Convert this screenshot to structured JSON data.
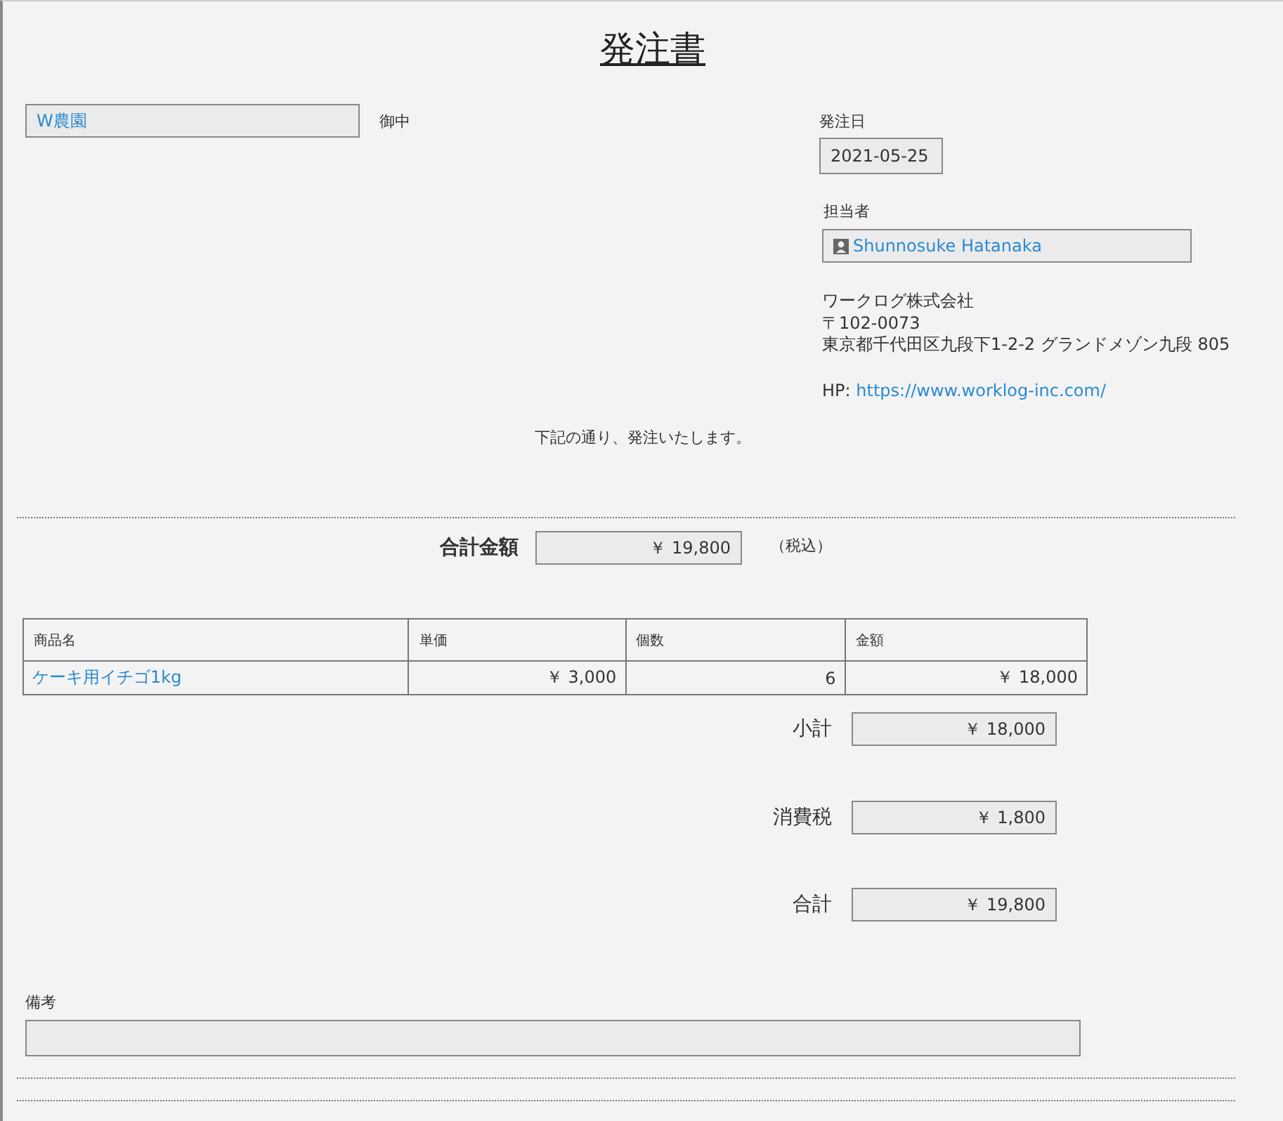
{
  "title": "発注書",
  "supplier": {
    "value": "W農園",
    "suffix": "御中"
  },
  "order_date": {
    "label": "発注日",
    "value": "2021-05-25"
  },
  "staff": {
    "label": "担当者",
    "value": "Shunnosuke Hatanaka"
  },
  "company": {
    "name": "ワークログ株式会社",
    "postal": "〒102-0073",
    "address": "東京都千代田区九段下1-2-2 グランドメゾン九段 805"
  },
  "homepage": {
    "label": "HP:",
    "url": "https://www.worklog-inc.com/"
  },
  "message": "下記の通り、発注いたします。",
  "total": {
    "label": "合計金額",
    "value": "￥ 19,800",
    "note": "（税込）"
  },
  "table": {
    "columns": [
      "商品名",
      "単価",
      "個数",
      "金額"
    ],
    "rows": [
      [
        "ケーキ用イチゴ1kg",
        "￥ 3,000",
        "6",
        "￥ 18,000"
      ]
    ]
  },
  "summary": [
    {
      "label": "小計",
      "value": "￥ 18,000"
    },
    {
      "label": "消費税",
      "value": "￥ 1,800"
    },
    {
      "label": "合計",
      "value": "￥ 19,800"
    }
  ],
  "remarks": {
    "label": "備考"
  }
}
